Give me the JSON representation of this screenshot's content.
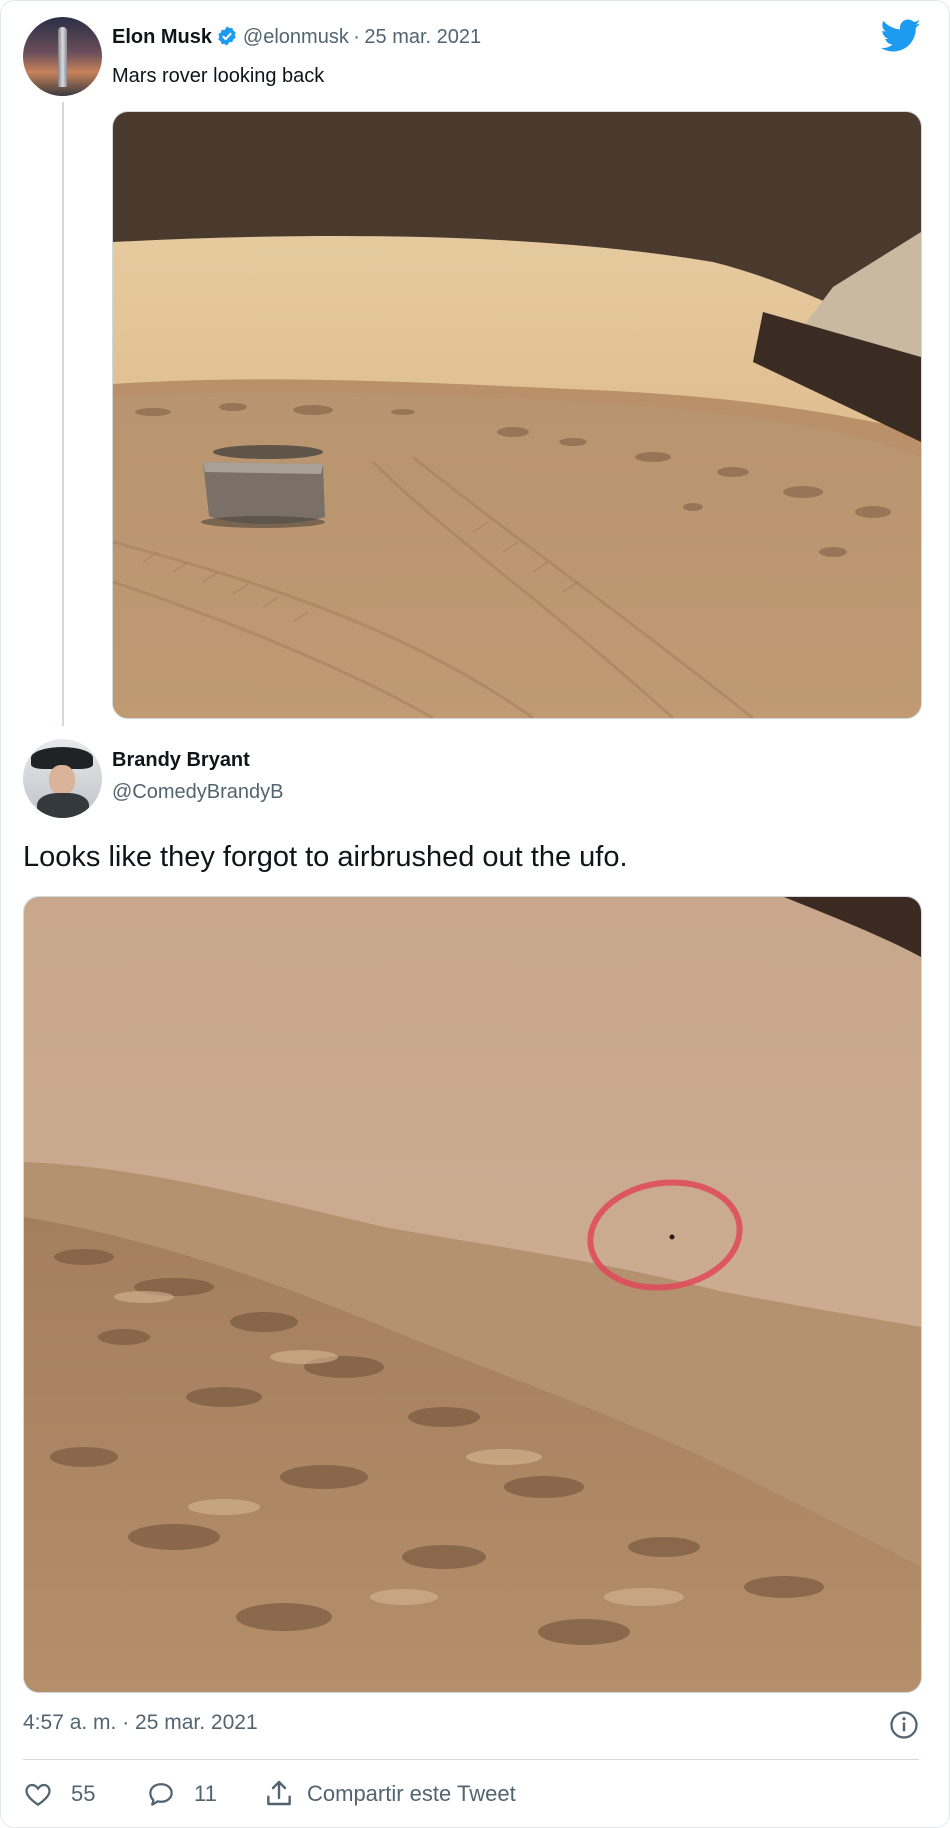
{
  "tweet": {
    "author_name": "Elon Musk",
    "author_handle": "@elonmusk",
    "separator": "·",
    "date": "25 mar. 2021",
    "text": "Mars rover looking back"
  },
  "reply": {
    "author_name": "Brandy Bryant",
    "author_handle": "@ComedyBrandyB",
    "text": "Looks like they forgot to airbrushed out the ufo.",
    "timestamp": "4:57 a. m. · 25 mar. 2021"
  },
  "actions": {
    "likes": "55",
    "replies": "11",
    "share_label": "Compartir este Tweet"
  },
  "colors": {
    "twitter_blue": "#1d9bf0",
    "text_primary": "#0f1419",
    "text_muted": "#536471",
    "ufo_circle": "#e0485a"
  },
  "icons": [
    "twitter-bird-icon",
    "verified-badge-icon",
    "info-icon",
    "heart-icon",
    "reply-icon",
    "share-icon"
  ]
}
